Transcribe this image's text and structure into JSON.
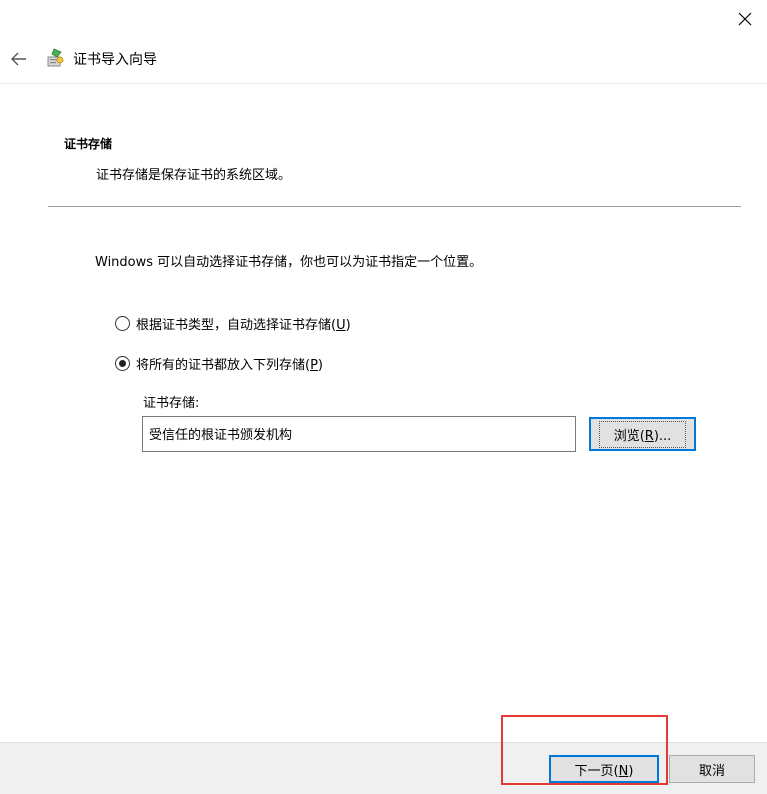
{
  "window": {
    "close_icon": "close-icon"
  },
  "header": {
    "back_icon": "arrow-left-icon",
    "app_icon": "certificate-wizard-icon",
    "title": "证书导入向导"
  },
  "section": {
    "heading": "证书存储",
    "description": "证书存储是保存证书的系统区域。"
  },
  "intro": "Windows 可以自动选择证书存储，你也可以为证书指定一个位置。",
  "options": [
    {
      "label_before": "根据证书类型，自动选择证书存储(",
      "mnemonic": "U",
      "label_after": ")",
      "checked": false
    },
    {
      "label_before": "将所有的证书都放入下列存储(",
      "mnemonic": "P",
      "label_after": ")",
      "checked": true
    }
  ],
  "store": {
    "label": "证书存储:",
    "value": "受信任的根证书颁发机构",
    "browse_before": "浏览(",
    "browse_mnemonic": "R",
    "browse_after": ")..."
  },
  "footer": {
    "next_before": "下一页(",
    "next_mnemonic": "N",
    "next_after": ")",
    "cancel": "取消"
  },
  "colors": {
    "accent": "#0078d7",
    "highlight": "#e53935"
  }
}
